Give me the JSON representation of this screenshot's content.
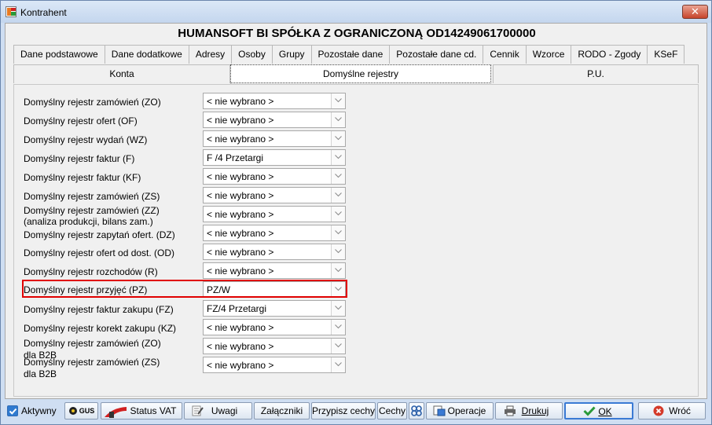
{
  "window": {
    "title": "Kontrahent",
    "close_label": "✕"
  },
  "company_name": "HUMANSOFT BI SPÓŁKA Z OGRANICZONĄ OD14249061700000",
  "tabs": [
    "Dane podstawowe",
    "Dane dodatkowe",
    "Adresy",
    "Osoby",
    "Grupy",
    "Pozostałe dane",
    "Pozostałe dane cd.",
    "Cennik",
    "Wzorce",
    "RODO - Zgody",
    "KSeF"
  ],
  "subtabs": [
    "Konta",
    "Domyślne rejestry",
    "P.U."
  ],
  "rows": [
    {
      "label": "Domyślny rejestr zamówień (ZO)",
      "value": "< nie wybrano >"
    },
    {
      "label": "Domyślny rejestr ofert (OF)",
      "value": "< nie wybrano >"
    },
    {
      "label": "Domyślny rejestr wydań (WZ)",
      "value": "< nie wybrano >"
    },
    {
      "label": "Domyślny rejestr faktur (F)",
      "value": "F /4  Przetargi"
    },
    {
      "label": "Domyślny rejestr faktur (KF)",
      "value": "< nie wybrano >"
    },
    {
      "label": "Domyślny rejestr zamówień (ZS)",
      "value": "< nie wybrano >"
    },
    {
      "label": "Domyślny rejestr zamówień (ZZ)",
      "label2": "(analiza produkcji, bilans zam.)",
      "value": "< nie wybrano >"
    },
    {
      "label": "Domyślny rejestr zapytań ofert. (DZ)",
      "value": "< nie wybrano >"
    },
    {
      "label": "Domyślny rejestr ofert od dost. (OD)",
      "value": "< nie wybrano >"
    },
    {
      "label": "Domyślny rejestr rozchodów (R)",
      "value": "< nie wybrano >"
    },
    {
      "label": "Domyślny rejestr przyjęć (PZ)",
      "value": "PZ/W"
    },
    {
      "label": "Domyślny rejestr faktur zakupu (FZ)",
      "value": "FZ/4  Przetargi"
    },
    {
      "label": "Domyślny rejestr korekt zakupu (KZ)",
      "value": "< nie wybrano >"
    },
    {
      "label": "Domyślny rejestr zamówień (ZO)",
      "label2": "dla B2B",
      "value": "< nie wybrano >"
    },
    {
      "label": "Domyślny rejestr zamówień (ZS)",
      "label2": "dla B2B",
      "value": "< nie wybrano >"
    }
  ],
  "bottom": {
    "active_label": "Aktywny",
    "gus_label": "GUS",
    "status_vat": "Status VAT",
    "uwagi": "Uwagi",
    "zalaczniki": "Załączniki",
    "przypisz_cechy": "Przypisz cechy",
    "cechy": "Cechy",
    "operacje": "Operacje",
    "drukuj": "Drukuj",
    "ok": "OK",
    "wroc": "Wróć"
  },
  "colors": {
    "highlight": "#e00000",
    "accent": "#3a7ad4"
  }
}
